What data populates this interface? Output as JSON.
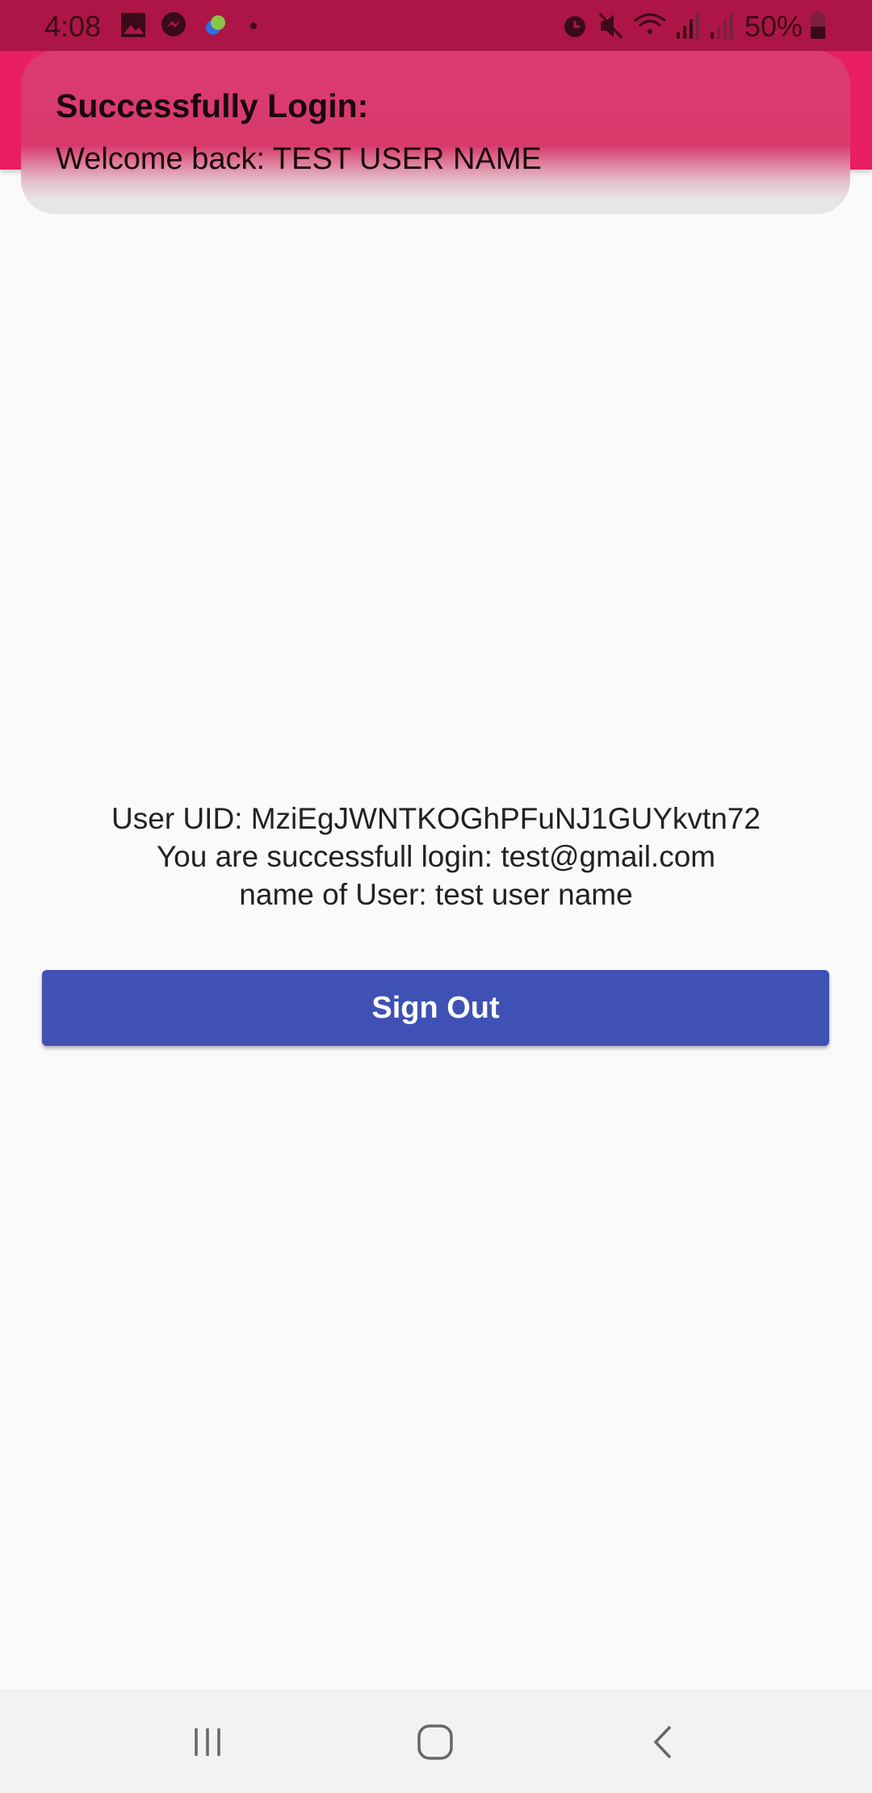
{
  "status_bar": {
    "time": "4:08",
    "battery": "50%"
  },
  "toast": {
    "title": "Successfully Login:",
    "message": "Welcome back: TEST USER NAME"
  },
  "info": {
    "uid_line": "User UID:  MziEgJWNTKOGhPFuNJ1GUYkvtn72",
    "login_line": "You are successfull login:  test@gmail.com",
    "name_line": "name of User:  test user name"
  },
  "buttons": {
    "sign_out": "Sign Out"
  },
  "colors": {
    "status_bar": "#ad1547",
    "app_bar": "#e91e63",
    "button": "#3f51b5"
  }
}
